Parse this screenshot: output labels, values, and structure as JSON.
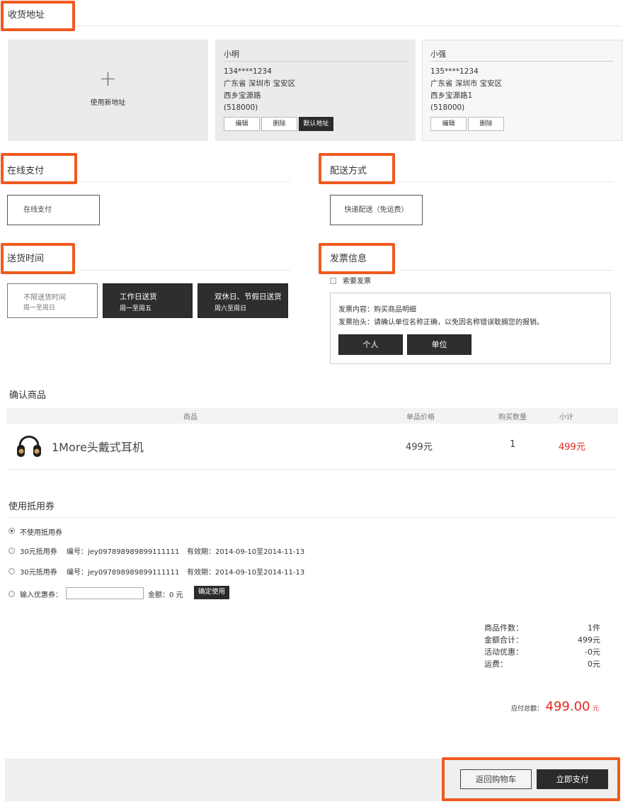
{
  "sections": {
    "address": "收货地址",
    "payment": "在线支付",
    "delivery": "配送方式",
    "time": "送货时间",
    "invoice": "发票信息",
    "confirm": "确认商品",
    "coupon": "使用抵用券"
  },
  "new_address": {
    "label": "使用新地址",
    "plus": "+"
  },
  "addresses": [
    {
      "name": "小明",
      "phone": "134****1234",
      "region": "广东省 深圳市 宝安区",
      "street": "西乡宝源路",
      "zip": "(518000)",
      "edit": "编辑",
      "delete": "删除",
      "default": "默认地址"
    },
    {
      "name": "小强",
      "phone": "135****1234",
      "region": "广东省 深圳市 宝安区",
      "street": "西乡宝源路1",
      "zip": "(518000)",
      "edit": "编辑",
      "delete": "删除"
    }
  ],
  "payment_option": "在线支付",
  "delivery_option": "快递配送（免运费）",
  "time_options": [
    {
      "title": "不限送货时间",
      "sub": "周一至周日"
    },
    {
      "title": "工作日送货",
      "sub": "周一至周五"
    },
    {
      "title": "双休日、节假日送货",
      "sub": "周六至周日"
    }
  ],
  "invoice": {
    "checkbox_label": "索要发票",
    "content": "发票内容：购买商品明细",
    "header": "发票抬头：请确认单位名称正确，以免因名称错误耽搁您的报销。",
    "personal": "个人",
    "company": "单位"
  },
  "table": {
    "headers": [
      "商品",
      "单品价格",
      "购买数量",
      "小计"
    ],
    "rows": [
      {
        "name": "1More头戴式耳机",
        "price": "499元",
        "qty": "1",
        "subtotal": "499元"
      }
    ]
  },
  "coupons": {
    "none": "不使用抵用券",
    "items": [
      {
        "name": "30元抵用券",
        "code": "编号：jey097898989899111111",
        "valid": "有效期：2014-09-10至2014-11-13"
      },
      {
        "name": "30元抵用券",
        "code": "编号：jey097898989899111111",
        "valid": "有效期：2014-09-10至2014-11-13"
      }
    ],
    "input_label": "输入优惠券：",
    "input_value": "",
    "amount": "金额：0 元",
    "confirm": "确定使用"
  },
  "summary": [
    {
      "label": "商品件数：",
      "value": "1件"
    },
    {
      "label": "金额合计：",
      "value": "499元"
    },
    {
      "label": "活动优惠：",
      "value": "-0元"
    },
    {
      "label": "运费：",
      "value": "0元"
    }
  ],
  "total": {
    "label": "应付总额：",
    "value": "499.00",
    "unit": "元"
  },
  "footer": {
    "back": "返回购物车",
    "pay": "立即支付"
  },
  "colors": {
    "highlight": "#f05a1e",
    "price_red": "#e5281f",
    "dark_button": "#2b2b2b"
  },
  "icons": {
    "product": "headphones-icon"
  }
}
